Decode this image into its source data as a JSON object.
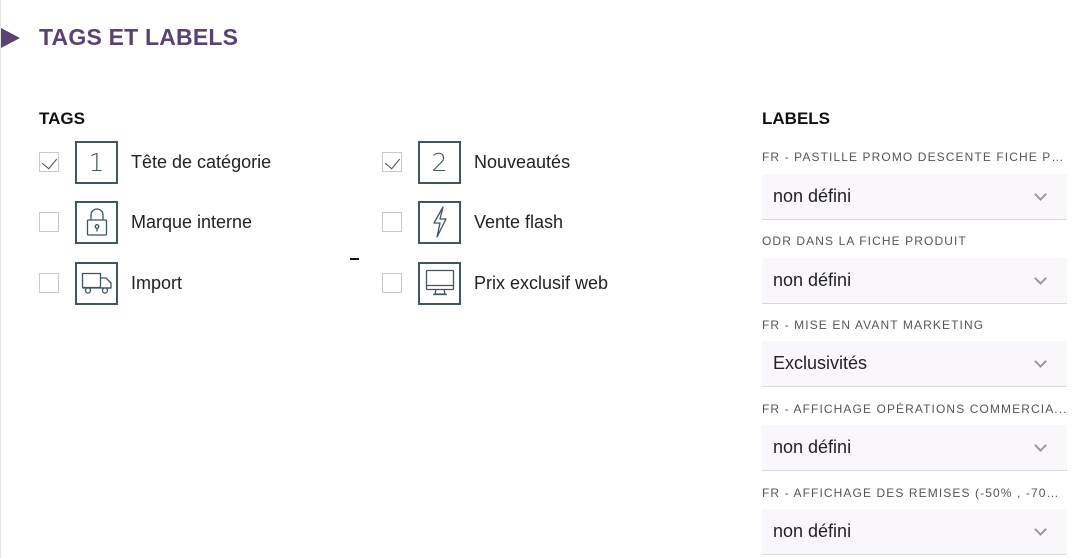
{
  "section": {
    "title": "TAGS ET LABELS"
  },
  "tags": {
    "title": "TAGS",
    "items": [
      {
        "label": "Tête de catégorie",
        "checked": true,
        "icon": "number-1-icon",
        "icon_text": "1"
      },
      {
        "label": "Nouveautés",
        "checked": true,
        "icon": "number-2-icon",
        "icon_text": "2"
      },
      {
        "label": "Marque interne",
        "checked": false,
        "icon": "padlock-icon"
      },
      {
        "label": "Vente flash",
        "checked": false,
        "icon": "lightning-bolt-icon"
      },
      {
        "label": "Import",
        "checked": false,
        "icon": "delivery-truck-icon"
      },
      {
        "label": "Prix exclusif web",
        "checked": false,
        "icon": "computer-monitor-icon"
      }
    ]
  },
  "labels": {
    "title": "LABELS",
    "fields": [
      {
        "caption": "FR - PASTILLE PROMO DESCENTE FICHE PR...",
        "value": "non défini"
      },
      {
        "caption": "ODR DANS LA FICHE PRODUIT",
        "value": "non défini"
      },
      {
        "caption": "FR - MISE EN AVANT MARKETING",
        "value": "Exclusivités"
      },
      {
        "caption": "FR - AFFICHAGE OPÉRATIONS COMMERCIA...",
        "value": "non défini"
      },
      {
        "caption": "FR - AFFICHAGE DES REMISES (-50% , -70%...",
        "value": "non défini"
      }
    ]
  },
  "colors": {
    "accent": "#5a4273",
    "icon_border": "#3f5560",
    "select_bg": "#faf7fc"
  }
}
